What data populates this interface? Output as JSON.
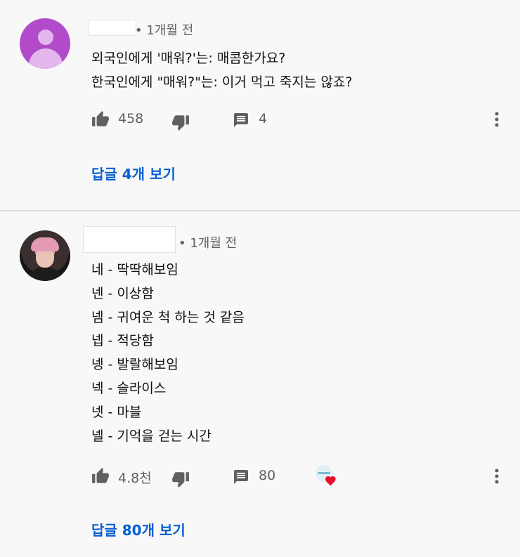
{
  "comments": [
    {
      "avatar": "default-user-avatar",
      "time": "• 1개월 전",
      "lines": [
        "외국인에게 '매워?'는: 매콤한가요?",
        "한국인에게 \"매워?\"는: 이거 먹고 죽지는 않죠?"
      ],
      "likes": "458",
      "replies": "4",
      "view_replies": "답글 4개 보기"
    },
    {
      "avatar": "photo-avatar",
      "time": "• 1개월 전",
      "lines": [
        "네 - 딱딱해보임",
        "넨 - 이상함",
        "넴 - 귀여운 척 하는 것 같음",
        "넵 - 적당함",
        "넹 - 발랄해보임",
        "넥 - 슬라이스",
        "넷 - 마블",
        "넬 - 기억을 걷는 시간"
      ],
      "likes": "4.8천",
      "replies": "80",
      "creator_heart": true,
      "view_replies": "답글 80개 보기"
    }
  ],
  "colors": {
    "link": "#065fd4",
    "heart": "#e8112d",
    "avatar_purple": "#b24bc9",
    "muted": "#606060"
  },
  "icons": [
    "like-icon",
    "dislike-icon",
    "reply-icon",
    "more-vert-icon",
    "heart-icon"
  ]
}
